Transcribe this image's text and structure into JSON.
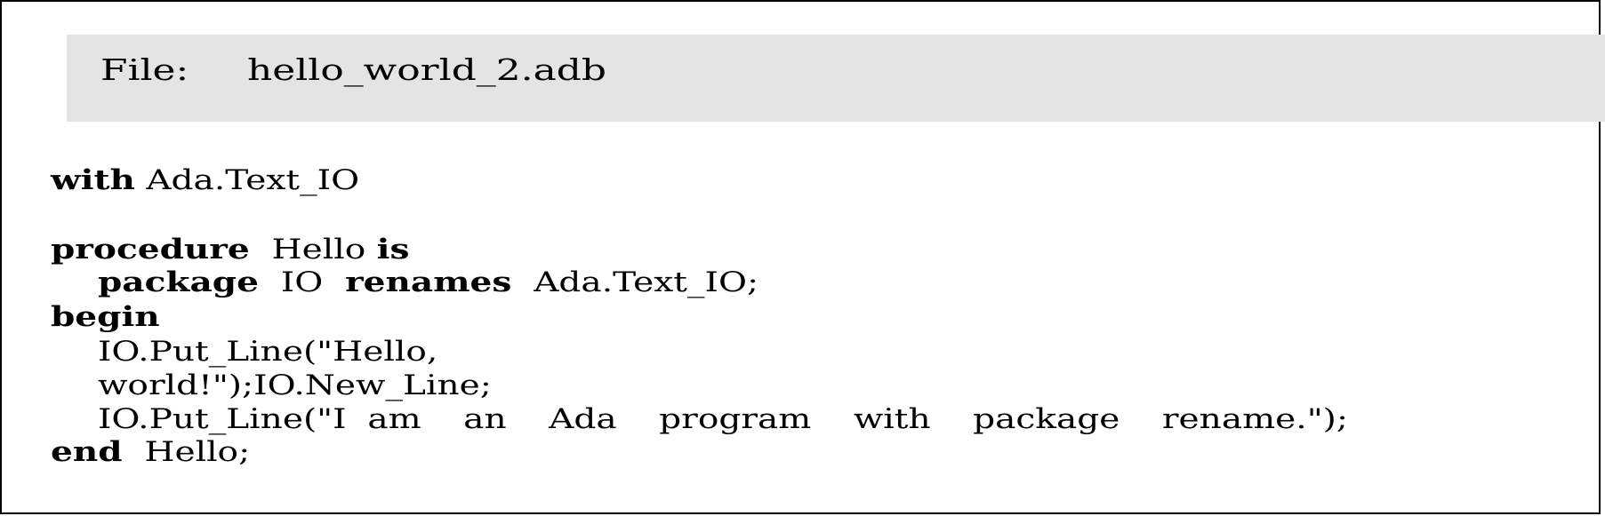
{
  "header": {
    "label": "File:",
    "filename": "hello_world_2.adb",
    "background_color": "#e4e4e4"
  },
  "code": {
    "language": "Ada",
    "lines": [
      {
        "indent": 0,
        "tokens": [
          {
            "text": "with",
            "kind": "keyword"
          },
          {
            "text": " Ada.Text_IO",
            "kind": "plain"
          }
        ]
      },
      {
        "indent": 0,
        "tokens": [
          {
            "text": "procedure",
            "kind": "keyword"
          },
          {
            "text": "  Hello ",
            "kind": "plain"
          },
          {
            "text": "is",
            "kind": "keyword"
          }
        ]
      },
      {
        "indent": 1,
        "tokens": [
          {
            "text": "package",
            "kind": "keyword"
          },
          {
            "text": "  IO  ",
            "kind": "plain"
          },
          {
            "text": "renames",
            "kind": "keyword"
          },
          {
            "text": "  Ada.Text_IO;",
            "kind": "plain"
          }
        ]
      },
      {
        "indent": 0,
        "tokens": [
          {
            "text": "begin",
            "kind": "keyword"
          }
        ]
      },
      {
        "indent": 1,
        "tokens": [
          {
            "text": "IO.Put_Line(\"Hello,",
            "kind": "plain"
          }
        ]
      },
      {
        "indent": 1,
        "tokens": [
          {
            "text": "world!\");IO.New_Line;",
            "kind": "plain"
          }
        ]
      },
      {
        "indent": 1,
        "tokens": [
          {
            "text": "IO.Put_Line(\"I am  an  Ada  program  with  package  rename.\");",
            "kind": "plain"
          }
        ]
      },
      {
        "indent": 0,
        "tokens": [
          {
            "text": "end",
            "kind": "keyword"
          },
          {
            "text": "  Hello;",
            "kind": "plain"
          }
        ]
      }
    ]
  }
}
